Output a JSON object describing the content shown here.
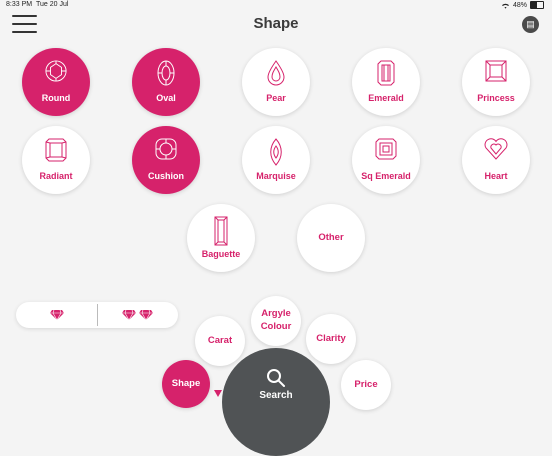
{
  "status_bar": {
    "time": "8:33 PM",
    "date": "Tue 20 Jul",
    "battery": "48%",
    "battery_level": 0.48,
    "wifi_icon": "wifi-icon"
  },
  "header": {
    "title": "Shape",
    "menu_icon": "hamburger-menu-icon",
    "notes_icon": "notes-icon"
  },
  "accent_color": "#d6226b",
  "shapes": [
    {
      "label": "Round",
      "selected": true,
      "icon": "round-diamond-icon"
    },
    {
      "label": "Oval",
      "selected": true,
      "icon": "oval-diamond-icon"
    },
    {
      "label": "Pear",
      "selected": false,
      "icon": "pear-diamond-icon"
    },
    {
      "label": "Emerald",
      "selected": false,
      "icon": "emerald-diamond-icon"
    },
    {
      "label": "Princess",
      "selected": false,
      "icon": "princess-diamond-icon"
    },
    {
      "label": "Radiant",
      "selected": false,
      "icon": "radiant-diamond-icon"
    },
    {
      "label": "Cushion",
      "selected": true,
      "icon": "cushion-diamond-icon"
    },
    {
      "label": "Marquise",
      "selected": false,
      "icon": "marquise-diamond-icon"
    },
    {
      "label": "Sq Emerald",
      "selected": false,
      "icon": "square-emerald-diamond-icon"
    },
    {
      "label": "Heart",
      "selected": false,
      "icon": "heart-diamond-icon"
    },
    {
      "label": "Baguette",
      "selected": false,
      "icon": "baguette-diamond-icon"
    },
    {
      "label": "Other",
      "selected": false,
      "icon": ""
    }
  ],
  "size_toggle": {
    "single_icon": "single-diamond-icon",
    "double_icon": "double-diamond-icon"
  },
  "filters": {
    "carat": "Carat",
    "argyle_line1": "Argyle",
    "argyle_line2": "Colour",
    "clarity": "Clarity",
    "shape": "Shape",
    "price": "Price",
    "search": "Search",
    "search_icon": "search-icon"
  }
}
